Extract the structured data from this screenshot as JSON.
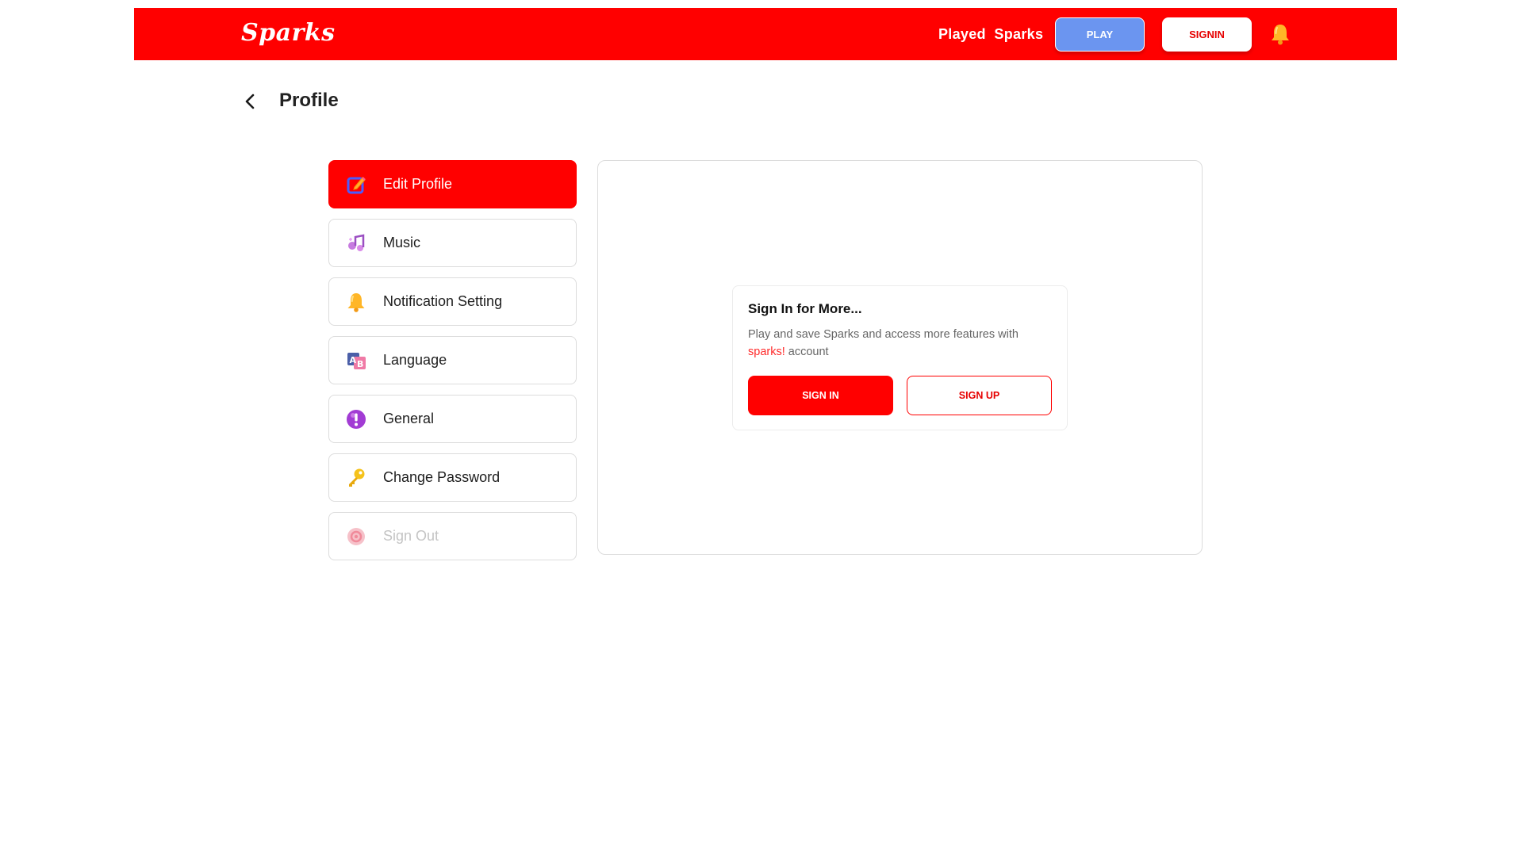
{
  "header": {
    "logo": "Sparks",
    "nav_link": "Played  Sparks",
    "play_button": "PLAY",
    "signin_button": "SIGNIN",
    "bell_icon": "bell-icon"
  },
  "page": {
    "title": "Profile",
    "back_icon": "chevron-left-icon"
  },
  "sidebar": {
    "items": [
      {
        "label": "Edit Profile",
        "icon": "edit-icon",
        "active": true
      },
      {
        "label": "Music",
        "icon": "music-icon"
      },
      {
        "label": "Notification Setting",
        "icon": "bell-icon"
      },
      {
        "label": "Language",
        "icon": "language-icon"
      },
      {
        "label": "General",
        "icon": "info-icon"
      },
      {
        "label": "Change Password",
        "icon": "key-icon"
      },
      {
        "label": "Sign Out",
        "icon": "sign-out-icon",
        "disabled": true
      }
    ]
  },
  "signin_card": {
    "title": "Sign In for More...",
    "description": "Play and save Sparks and access more features with",
    "brand": "sparks!",
    "description_end": " account",
    "signin_button": "SIGN IN",
    "signup_button": "SIGN UP"
  },
  "colors": {
    "brand_red": "#ff0000",
    "play_blue": "#6b95f0"
  }
}
